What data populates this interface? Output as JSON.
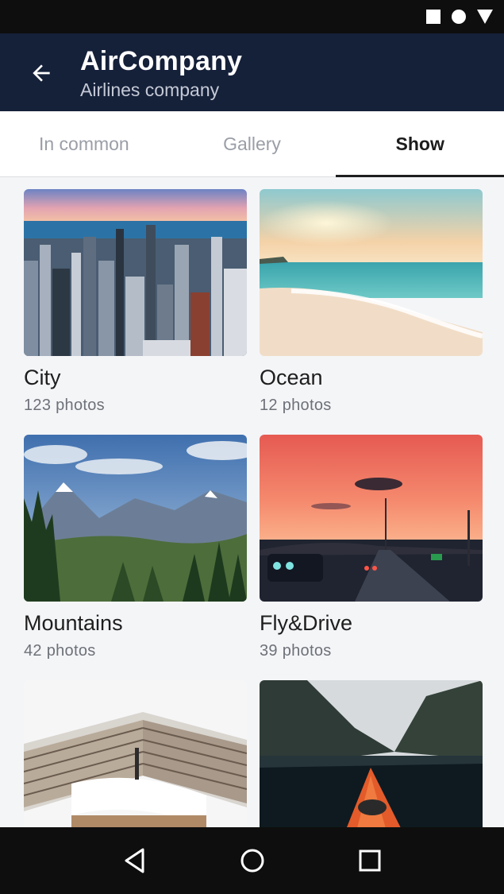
{
  "status_bar": {
    "icons": [
      "square-icon",
      "circle-icon",
      "triangle-down-icon"
    ]
  },
  "app_bar": {
    "title": "AirCompany",
    "subtitle": "Airlines company",
    "back_icon": "arrow-left-icon",
    "background": "#152039"
  },
  "tabs": [
    {
      "label": "In common",
      "active": false
    },
    {
      "label": "Gallery",
      "active": false
    },
    {
      "label": "Show",
      "active": true
    }
  ],
  "albums": [
    {
      "title": "City",
      "count": "123 photos"
    },
    {
      "title": "Ocean",
      "count": "12 photos"
    },
    {
      "title": "Mountains",
      "count": "42 photos"
    },
    {
      "title": "Fly&Drive",
      "count": "39 photos"
    },
    {
      "title": "",
      "count": ""
    },
    {
      "title": "",
      "count": ""
    }
  ],
  "nav_bar": {
    "icons": [
      "back-triangle-icon",
      "home-circle-icon",
      "recents-square-icon"
    ]
  }
}
